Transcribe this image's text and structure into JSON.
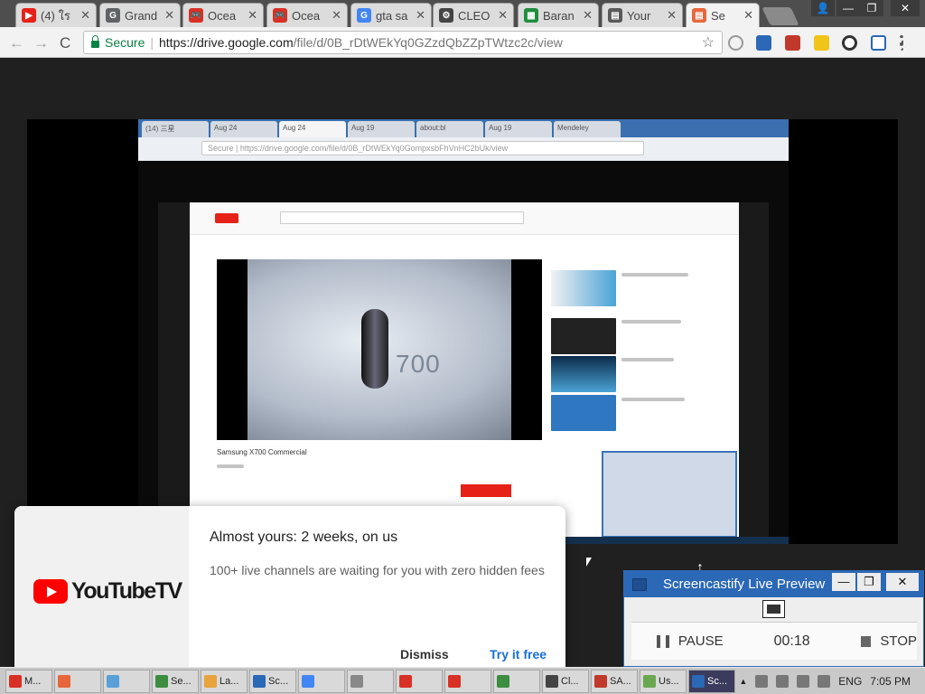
{
  "chrome": {
    "tabs": [
      {
        "label": "(4) ใร",
        "color": "#e62117",
        "glyph": "▶"
      },
      {
        "label": "Grand",
        "color": "#5f6368",
        "glyph": "G"
      },
      {
        "label": "Ocea",
        "color": "#d93025",
        "glyph": "🎮"
      },
      {
        "label": "Ocea",
        "color": "#d93025",
        "glyph": "🎮"
      },
      {
        "label": "gta sa",
        "color": "#4285f4",
        "glyph": "G"
      },
      {
        "label": "CLEO",
        "color": "#444444",
        "glyph": "⚙"
      },
      {
        "label": "Baran",
        "color": "#1e8e3e",
        "glyph": "▦"
      },
      {
        "label": "Your",
        "color": "#5a5a5a",
        "glyph": "▤"
      },
      {
        "label": "Se",
        "color": "#e8663c",
        "glyph": "▤",
        "active": true
      }
    ],
    "tab_close": "✕",
    "window_controls": {
      "minimize": "—",
      "maximize": "❐",
      "close": "✕"
    },
    "back": "←",
    "forward": "→",
    "reload": "C",
    "secure_label": "Secure",
    "separator": "|",
    "url_host": "https://drive.google.com",
    "url_path": "/file/d/0B_rDtWEkYq0GZzdQbZZpTWtzc2c/view",
    "bookmark_star": "☆"
  },
  "inner_capture": {
    "tabs": [
      "(14) 三星",
      "Aug 24",
      "Aug 24",
      "Aug 19",
      "about:bl",
      "Aug 19",
      "Mendeley"
    ],
    "url": "Secure | https://drive.google.com/file/d/0B_rDtWEkYq0GompxsbFhVnHC2bUk/view",
    "video_title_text": "Samsung X700 Commercial",
    "phone_text": "700"
  },
  "promo": {
    "logo_text": "YouTubeTV",
    "title": "Almost yours: 2 weeks, on us",
    "subtitle": "100+ live channels are waiting for you with zero hidden fees",
    "dismiss": "Dismiss",
    "try_free": "Try it free"
  },
  "screencastify": {
    "title": "Screencastify Live Preview",
    "minimize": "—",
    "maximize": "❐",
    "close": "✕",
    "pause": "PAUSE",
    "time": "00:18",
    "stop": "STOP"
  },
  "taskbar": {
    "items": [
      {
        "label": "M...",
        "color": "#d93025"
      },
      {
        "label": "",
        "color": "#e8663c"
      },
      {
        "label": "",
        "color": "#5aa0d8"
      },
      {
        "label": "Se...",
        "color": "#3c8d40"
      },
      {
        "label": "La...",
        "color": "#e8a33c"
      },
      {
        "label": "Sc...",
        "color": "#2b68b6"
      },
      {
        "label": "",
        "color": "#4285f4"
      },
      {
        "label": "",
        "color": "#888888"
      },
      {
        "label": "",
        "color": "#d93025"
      },
      {
        "label": "",
        "color": "#d93025"
      },
      {
        "label": "",
        "color": "#3c8d40"
      },
      {
        "label": "Cl...",
        "color": "#444444"
      },
      {
        "label": "SA...",
        "color": "#c0392b"
      },
      {
        "label": "Us...",
        "color": "#6aa84f"
      },
      {
        "label": "Sc...",
        "color": "#2b68b6",
        "active": true
      }
    ],
    "language": "ENG",
    "time": "7:05 PM"
  }
}
